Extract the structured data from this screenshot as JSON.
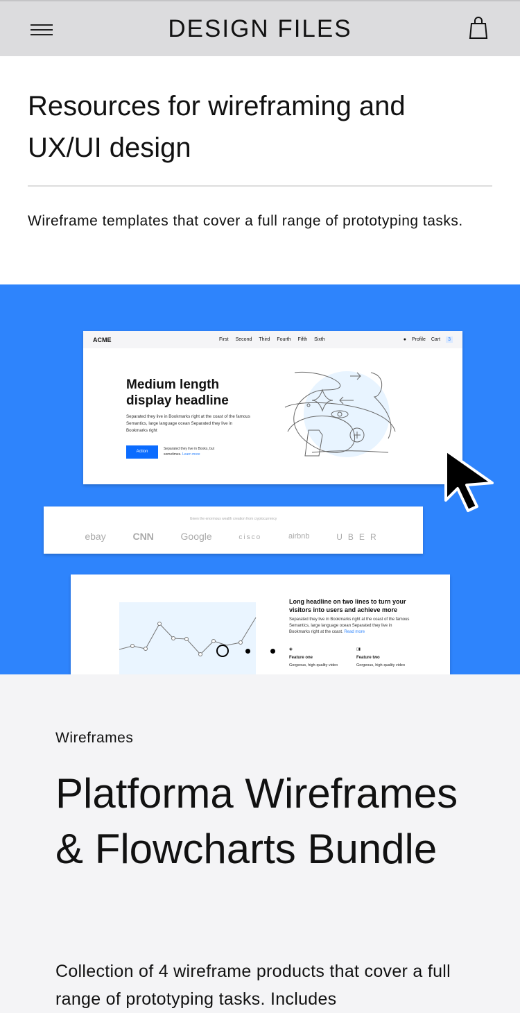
{
  "header": {
    "title": "DESIGN FILES",
    "menu_icon": "hamburger-icon",
    "cart_icon": "shopping-bag-icon"
  },
  "intro": {
    "title": "Resources for wireframing and UX/UI design",
    "description": "Wireframe templates that cover a full range of prototyping tasks."
  },
  "preview": {
    "background": "#2e84fc",
    "mock_nav": {
      "logo": "ACME",
      "links": [
        "First",
        "Second",
        "Third",
        "Fourth",
        "Fifth",
        "Sixth"
      ],
      "profile": "Profile",
      "cart": "Cart",
      "cart_count": "3"
    },
    "hero": {
      "headline": "Medium length display headline",
      "text": "Separated they live in Bookmarks right at the coast of the famous Semantics, large language ocean Separated they live in Bookmarks right",
      "button": "Action",
      "sub": "Separated they live in Books, but sometimes.",
      "sub_link": "Learn more"
    },
    "logos": {
      "caption": "Given the enormous wealth creation from cryptocurrency",
      "items": [
        "ebay",
        "CNN",
        "Google",
        "cisco",
        "airbnb",
        "UBER"
      ]
    },
    "feature": {
      "headline": "Long headline on two lines to turn your visitors into users and achieve more",
      "text": "Separated they live in Bookmarks right at the coast of the famous Semantics, large language ocean Separated they live in Bookmarks right at the coast.",
      "link": "Read more",
      "items": [
        {
          "title": "Feature one",
          "text": "Gorgeous, high-quality video"
        },
        {
          "title": "Feature two",
          "text": "Gorgeous, high-quality video"
        }
      ]
    }
  },
  "product": {
    "category": "Wireframes",
    "title": "Platforma Wireframes & Flowcharts Bundle",
    "description": "Collection of 4 wireframe products that cover a full range of prototyping tasks. Includes"
  }
}
